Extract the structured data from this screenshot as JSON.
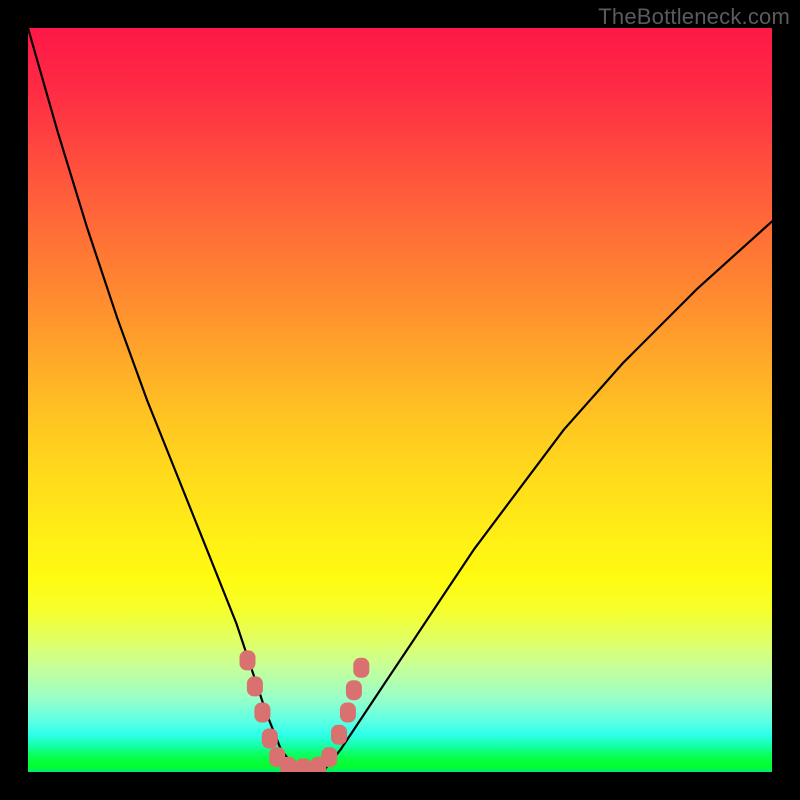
{
  "watermark": "TheBottleneck.com",
  "colors": {
    "background_frame": "#000000",
    "gradient_top": "#fe1847",
    "gradient_mid": "#ffda1c",
    "gradient_bottom": "#01e873",
    "curve_stroke": "#000000",
    "marker_fill": "#d97171",
    "watermark_text": "#5a5b5c"
  },
  "chart_data": {
    "type": "line",
    "title": "",
    "xlabel": "",
    "ylabel": "",
    "xlim": [
      0,
      100
    ],
    "ylim": [
      0,
      100
    ],
    "note": "Y-axis is inverted visually: 0 = top, 100 = bottom. The curve is a V-shaped dip reaching the bottom (green zone) around x≈34–40. Values are percent-of-plot estimates read from pixel positions since no axis ticks are shown.",
    "series": [
      {
        "name": "bottleneck-curve",
        "x": [
          0,
          4,
          8,
          12,
          16,
          20,
          24,
          28,
          30,
          32,
          34,
          36,
          38,
          40,
          42,
          44,
          48,
          52,
          56,
          60,
          66,
          72,
          80,
          90,
          100
        ],
        "y": [
          0,
          14,
          27,
          39,
          50,
          60,
          70,
          80,
          86,
          92,
          97,
          99.5,
          99.8,
          99.5,
          97,
          94,
          88,
          82,
          76,
          70,
          62,
          54,
          45,
          35,
          26
        ]
      }
    ],
    "markers": {
      "name": "highlighted-points",
      "note": "Salmon-colored rounded markers clustered near the curve minimum along the bottom edge.",
      "points": [
        {
          "x": 29.5,
          "y": 85
        },
        {
          "x": 30.5,
          "y": 88.5
        },
        {
          "x": 31.5,
          "y": 92
        },
        {
          "x": 32.5,
          "y": 95.5
        },
        {
          "x": 33.5,
          "y": 98
        },
        {
          "x": 35,
          "y": 99.3
        },
        {
          "x": 37,
          "y": 99.5
        },
        {
          "x": 39,
          "y": 99.3
        },
        {
          "x": 40.5,
          "y": 98
        },
        {
          "x": 41.8,
          "y": 95
        },
        {
          "x": 43,
          "y": 92
        },
        {
          "x": 43.8,
          "y": 89
        },
        {
          "x": 44.8,
          "y": 86
        }
      ]
    }
  }
}
